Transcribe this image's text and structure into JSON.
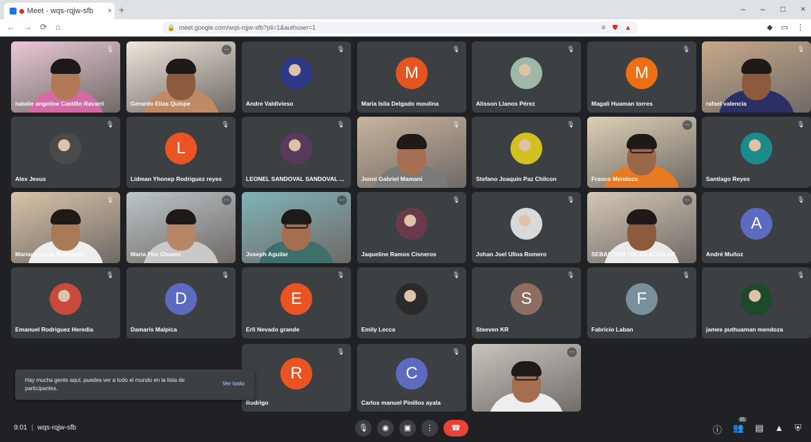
{
  "browser": {
    "tab_title": "Meet - wqs-rqjw-sfb",
    "tab_close": "×",
    "new_tab": "+",
    "url": "meet.google.com/wqs-rqjw-sfb?pli=1&authuser=1",
    "window_controls": [
      "–",
      "–",
      "□",
      "×"
    ],
    "nav_icons": [
      "←",
      "→",
      "⟳",
      "⌂"
    ]
  },
  "participants": [
    {
      "name": "natalie angeline Castillo Ravarri",
      "kind": "video",
      "bg": "#e9c8d6",
      "shirt": "#d46aa5",
      "skin": "#b07a58"
    },
    {
      "name": "Gerardo Elias Quispe",
      "kind": "video",
      "bg": "#efe6dc",
      "shirt": "#c08a64",
      "skin": "#8c5a3c",
      "badge": true
    },
    {
      "name": "Andre Valdivieso",
      "kind": "photo",
      "color": "#2d3a8a"
    },
    {
      "name": "Maria Isila Delgado moulina",
      "kind": "letter",
      "letter": "M",
      "color": "#e8541f"
    },
    {
      "name": "Alisson Llanos Pérez",
      "kind": "photo",
      "color": "#9fb7a8"
    },
    {
      "name": "Magali Huaman torres",
      "kind": "letter",
      "letter": "M",
      "color": "#ee6e13"
    },
    {
      "name": "rafael valencia",
      "kind": "video",
      "bg": "#c7a98a",
      "shirt": "#2b2f63",
      "skin": "#8c5a3c"
    },
    {
      "name": "Alex Jesus",
      "kind": "photo",
      "color": "#4a4a4a"
    },
    {
      "name": "Lidman Yhonep Rodriguez reyes",
      "kind": "letter",
      "letter": "L",
      "color": "#ea5422"
    },
    {
      "name": "LEONEL SANDOVAL SANDOVAL ...",
      "kind": "photo",
      "color": "#5a3a5a"
    },
    {
      "name": "Jonni Gabriel Mamani",
      "kind": "video",
      "bg": "#c9b39e",
      "shirt": "#7a7a7a",
      "skin": "#a57052"
    },
    {
      "name": "Stefano Joaquin Paz Chilcon",
      "kind": "photo",
      "color": "#d4c020"
    },
    {
      "name": "Franco Mendoza",
      "kind": "video",
      "bg": "#dcd0b5",
      "shirt": "#e87a23",
      "skin": "#9a6848",
      "badge": true,
      "glasses": true
    },
    {
      "name": "Santiago Reyes",
      "kind": "photo",
      "color": "#1a8a8a"
    },
    {
      "name": "Mariana Lucia Rodriguez",
      "kind": "video",
      "bg": "#d8c3a8",
      "shirt": "#eeeeee",
      "skin": "#a97a58"
    },
    {
      "name": "Maria Flor Chavez",
      "kind": "video",
      "bg": "#bcc5c8",
      "shirt": "#c9c9c9",
      "skin": "#b58766",
      "badge": true
    },
    {
      "name": "Joseph Aguilar",
      "kind": "video",
      "bg": "#7fb3b8",
      "shirt": "#3f6f6a",
      "skin": "#a56e4e",
      "badge": true,
      "glasses": true
    },
    {
      "name": "Jaqueline Ramos Cisneros",
      "kind": "photo",
      "color": "#6a3a4a"
    },
    {
      "name": "Johan Joel Ulloa Romero",
      "kind": "photo",
      "color": "#d9d9d9"
    },
    {
      "name": "SEBASTIAN TOCTO AGUILAR",
      "kind": "video",
      "bg": "#d3c7b6",
      "shirt": "#e9e9e9",
      "skin": "#8c5a3c",
      "badge": true
    },
    {
      "name": "André Muñoz",
      "kind": "letter",
      "letter": "A",
      "color": "#5c6bc0"
    },
    {
      "name": "Emanuel Rodriguez Heredia",
      "kind": "photo",
      "color": "#c84a3a"
    },
    {
      "name": "Damaris Malpica",
      "kind": "letter",
      "letter": "D",
      "color": "#5c6bc0"
    },
    {
      "name": "Erli Nevado grande",
      "kind": "letter",
      "letter": "E",
      "color": "#ea5422"
    },
    {
      "name": "Emily Lecca",
      "kind": "photo",
      "color": "#2a2a2a"
    },
    {
      "name": "Steeven KR",
      "kind": "letter",
      "letter": "S",
      "color": "#8d6e63"
    },
    {
      "name": "Fabricio Laban",
      "kind": "letter",
      "letter": "F",
      "color": "#78909c"
    },
    {
      "name": "james puthuaman mendoza",
      "kind": "photo",
      "color": "#1f4a2a"
    },
    {
      "name": "Rodrigo",
      "kind": "letter",
      "letter": "R",
      "color": "#ea5422"
    },
    {
      "name": "Carlos manuel Pinillos ayala",
      "kind": "letter",
      "letter": "C",
      "color": "#5c6bc0"
    },
    {
      "name": "",
      "kind": "video",
      "bg": "#c8c3bd",
      "shirt": "#eeeeee",
      "skin": "#a56e4e",
      "badge": true,
      "glasses": true,
      "highlight": true
    }
  ],
  "toast": {
    "message": "Hay mucha gente aquí, puedes ver a todo el mundo en la lista de participantes.",
    "action": "Ver todo"
  },
  "bottom": {
    "time": "9:01",
    "separator": "|",
    "meeting_code": "wqs-rqjw-sfb",
    "participant_count": "31"
  }
}
